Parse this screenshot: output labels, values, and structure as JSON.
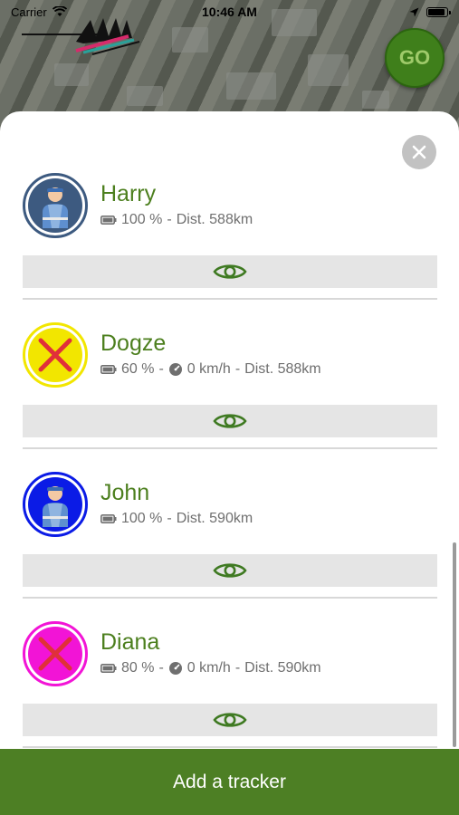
{
  "statusbar": {
    "carrier": "Carrier",
    "time": "10:46 AM"
  },
  "map": {
    "go_label": "GO"
  },
  "trackers": [
    {
      "name": "Harry",
      "battery": "100 %",
      "speed": null,
      "distance": "Dist. 588km",
      "avatar": "person",
      "ring_color": "#3d5a80",
      "fill_color": "#3d5a80"
    },
    {
      "name": "Dogze",
      "battery": "60 %",
      "speed": "0 km/h",
      "distance": "Dist. 588km",
      "avatar": "cross",
      "ring_color": "#f2e600",
      "fill_color": "#f2e600"
    },
    {
      "name": "John",
      "battery": "100 %",
      "speed": null,
      "distance": "Dist. 590km",
      "avatar": "person",
      "ring_color": "#0b1be6",
      "fill_color": "#0b1be6"
    },
    {
      "name": "Diana",
      "battery": "80 %",
      "speed": "0 km/h",
      "distance": "Dist. 590km",
      "avatar": "cross",
      "ring_color": "#f214d6",
      "fill_color": "#f214d6"
    }
  ],
  "separator": "-",
  "add_button": {
    "label": "Add a tracker"
  },
  "colors": {
    "accent": "#4d7f24",
    "name_green": "#4c7f1e",
    "eye_green": "#3f7a22"
  }
}
